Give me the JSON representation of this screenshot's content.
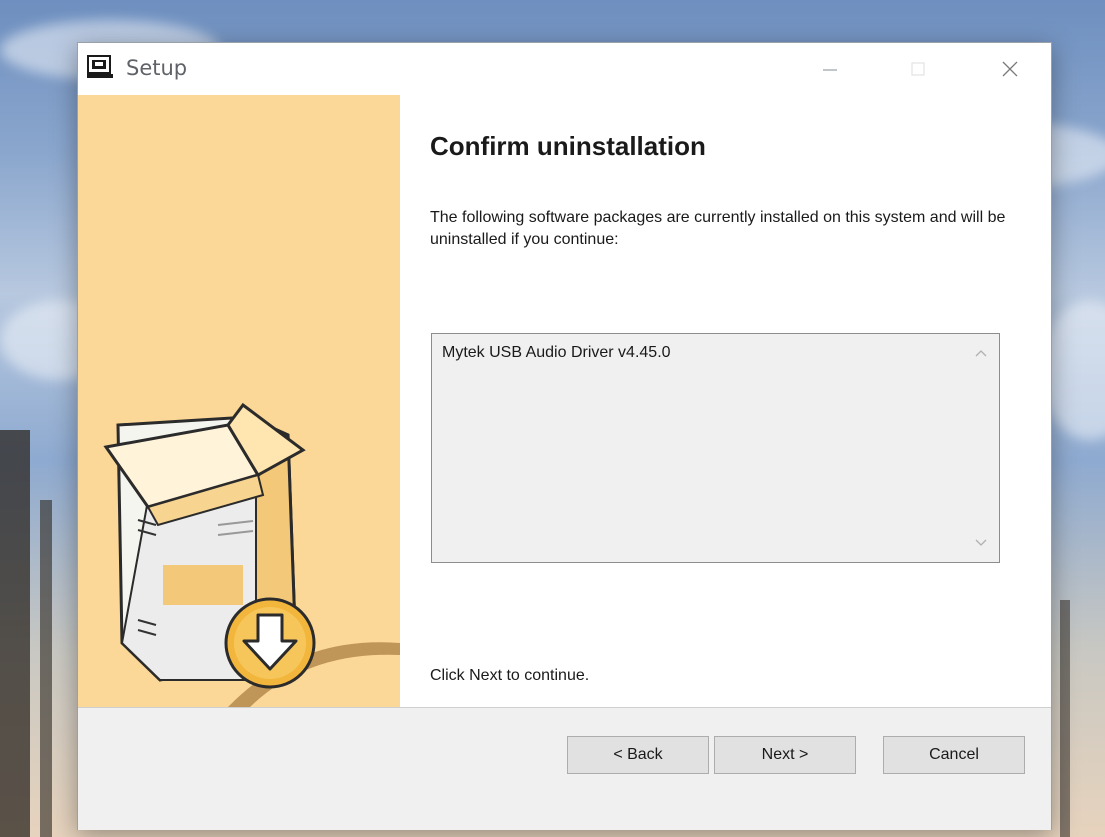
{
  "window": {
    "title": "Setup",
    "controls": {
      "minimize": "minimize-icon",
      "maximize": "maximize-icon",
      "close": "close-icon"
    }
  },
  "page": {
    "heading": "Confirm uninstallation",
    "description": "The following software packages are currently installed on this system and will be uninstalled if you continue:",
    "packages": [
      "Mytek USB Audio Driver v4.45.0"
    ],
    "continue_hint": "Click Next to continue."
  },
  "buttons": {
    "back": "< Back",
    "next": "Next >",
    "cancel": "Cancel"
  },
  "colors": {
    "side_panel": "#fbd897",
    "window_bg": "#ffffff",
    "footer_bg": "#f0f0f0"
  }
}
